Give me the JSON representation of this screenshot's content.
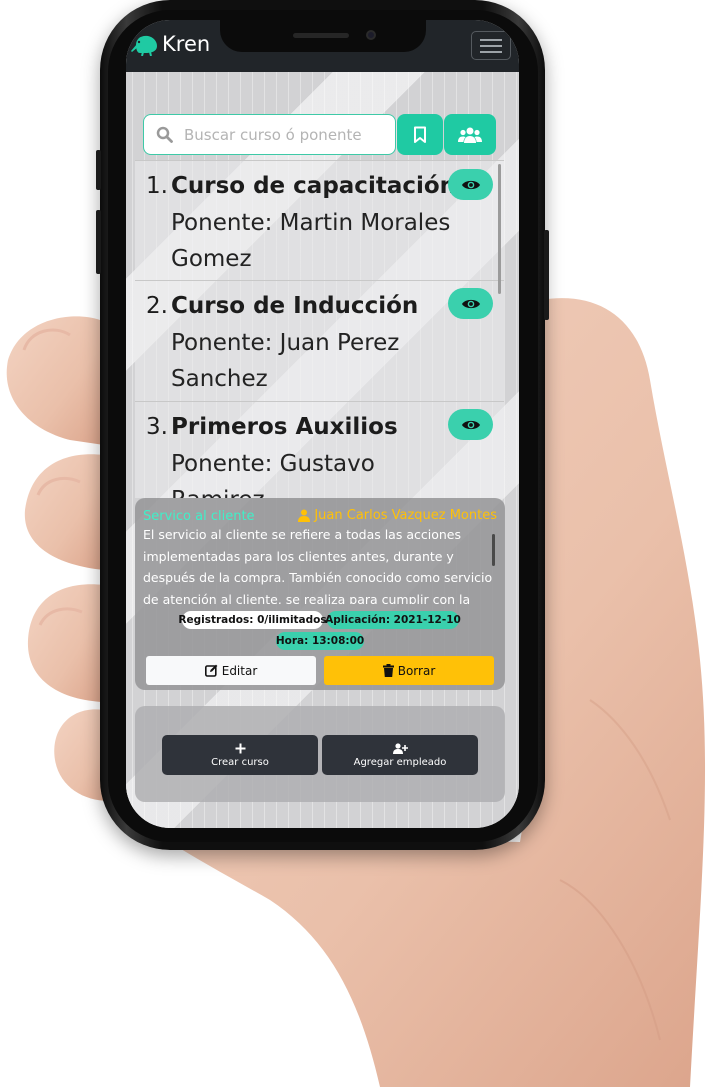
{
  "app": {
    "brand": "Kren"
  },
  "search": {
    "placeholder": "Buscar curso ó ponente",
    "value": ""
  },
  "courses": [
    {
      "number": "1.",
      "title": "Curso de capacitación",
      "speaker": "Ponente: Martin Morales Gomez"
    },
    {
      "number": "2.",
      "title": "Curso de Inducción",
      "speaker": "Ponente: Juan Perez Sanchez"
    },
    {
      "number": "3.",
      "title": "Primeros Auxilios",
      "speaker": "Ponente: Gustavo Ramirez"
    }
  ],
  "detail": {
    "category": "Servico al cliente",
    "owner": "Juan Carlos Vazquez Montes",
    "description": "El servicio al cliente se refiere a todas las acciones implementadas para los clientes antes, durante y después de la compra. También conocido como servicio de atención al cliente, se realiza para cumplir con la",
    "registered": "Registrados: 0/ilimitados",
    "application": "Aplicación: 2021-12-10",
    "time": "Hora: 13:08:00",
    "edit_label": "Editar",
    "delete_label": "Borrar"
  },
  "footer": {
    "create_label": "Crear curso",
    "add_employee_label": "Agregar empleado"
  },
  "colors": {
    "accent": "#1fcaa3",
    "dark": "#212529",
    "warning": "#ffc107"
  }
}
